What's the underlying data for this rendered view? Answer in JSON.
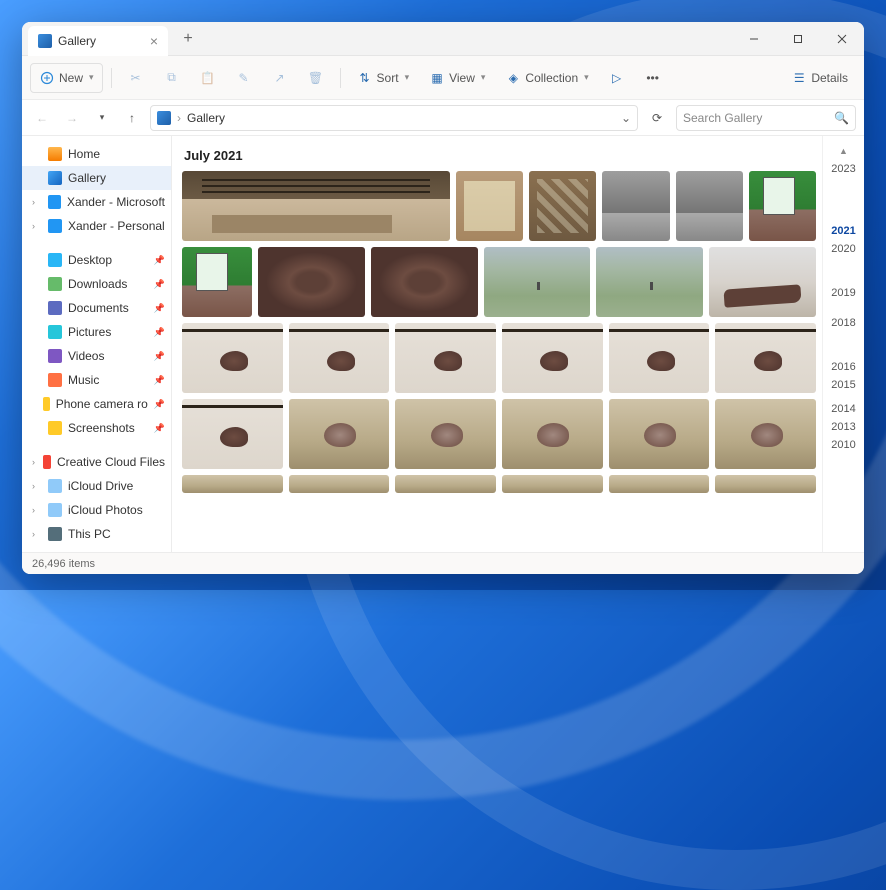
{
  "window": {
    "title": "Gallery"
  },
  "toolbar": {
    "new_label": "New",
    "sort_label": "Sort",
    "view_label": "View",
    "collection_label": "Collection",
    "details_label": "Details"
  },
  "breadcrumb": {
    "location": "Gallery"
  },
  "search": {
    "placeholder": "Search Gallery"
  },
  "sidebar": {
    "home": "Home",
    "gallery": "Gallery",
    "cloud1": "Xander - Microsoft",
    "cloud2": "Xander - Personal",
    "desktop": "Desktop",
    "downloads": "Downloads",
    "documents": "Documents",
    "pictures": "Pictures",
    "videos": "Videos",
    "music": "Music",
    "phone": "Phone camera ro",
    "screenshots": "Screenshots",
    "ccf": "Creative Cloud Files",
    "icloud_drive": "iCloud Drive",
    "icloud_photos": "iCloud Photos",
    "thispc": "This PC"
  },
  "gallery": {
    "section": "July 2021"
  },
  "timeline": {
    "y2023": "2023",
    "y2021": "2021",
    "y2020": "2020",
    "y2019": "2019",
    "y2018": "2018",
    "y2016": "2016",
    "y2015": "2015",
    "y2014": "2014",
    "y2013": "2013",
    "y2010": "2010"
  },
  "status": {
    "items": "26,496 items"
  }
}
